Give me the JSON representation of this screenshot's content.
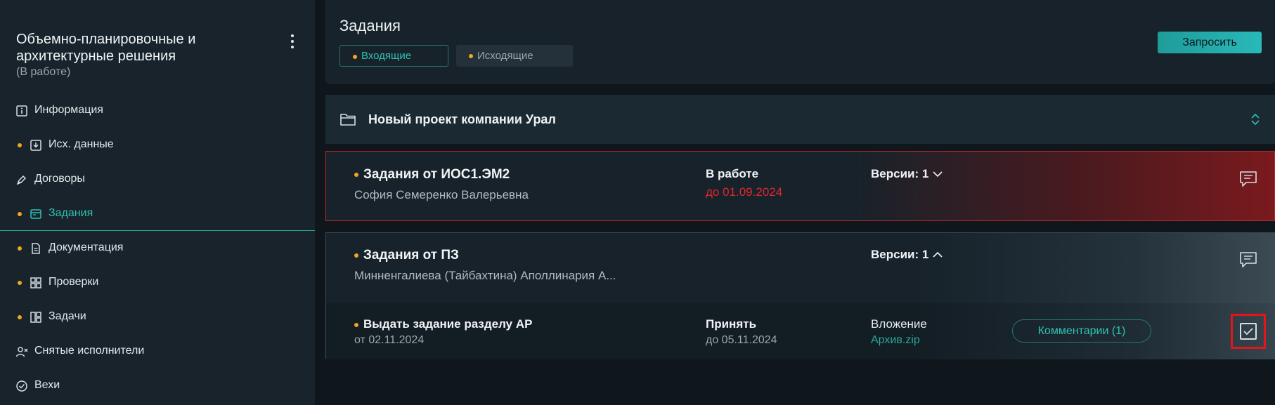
{
  "sidebar": {
    "project_title": "Объемно-планировочные и архитектурные решения",
    "project_status": "(В работе)",
    "items": [
      {
        "label": "Информация",
        "icon": "info-icon",
        "dot": false,
        "active": false
      },
      {
        "label": "Исх. данные",
        "icon": "download-icon",
        "dot": true,
        "active": false
      },
      {
        "label": "Договоры",
        "icon": "pen-icon",
        "dot": false,
        "active": false
      },
      {
        "label": "Задания",
        "icon": "window-icon",
        "dot": true,
        "active": true
      },
      {
        "label": "Документация",
        "icon": "document-icon",
        "dot": true,
        "active": false
      },
      {
        "label": "Проверки",
        "icon": "grid-icon",
        "dot": true,
        "active": false
      },
      {
        "label": "Задачи",
        "icon": "board-icon",
        "dot": true,
        "active": false
      },
      {
        "label": "Снятые исполнители",
        "icon": "user-remove-icon",
        "dot": false,
        "active": false
      },
      {
        "label": "Вехи",
        "icon": "check-circle-icon",
        "dot": false,
        "active": false
      }
    ]
  },
  "header": {
    "title": "Задания",
    "tabs": [
      {
        "label": "Входящие",
        "active": true
      },
      {
        "label": "Исходящие",
        "active": false
      }
    ],
    "request_button": "Запросить"
  },
  "project": {
    "title": "Новый проект компании Урал"
  },
  "tasks": [
    {
      "title": "Задания от ИОС1.ЭМ2",
      "author": "София Семеренко Валерьевна",
      "status": "В работе",
      "deadline": "до 01.09.2024",
      "versions": "Версии: 1"
    },
    {
      "title": "Задания от ПЗ",
      "author": "Минненгалиева (Тайбахтина) Аполлинария А...",
      "versions": "Версии: 1",
      "subtask": {
        "title": "Выдать задание разделу АР",
        "date": "от 02.11.2024",
        "status": "Принять",
        "deadline": "до 05.11.2024",
        "attachment_label": "Вложение",
        "attachment_file": "Архив.zip",
        "comments_button": "Комментарии (1)"
      }
    }
  ],
  "colors": {
    "accent": "#2fc1b4",
    "warning_dot": "#f0a527",
    "danger": "#e3272f"
  }
}
